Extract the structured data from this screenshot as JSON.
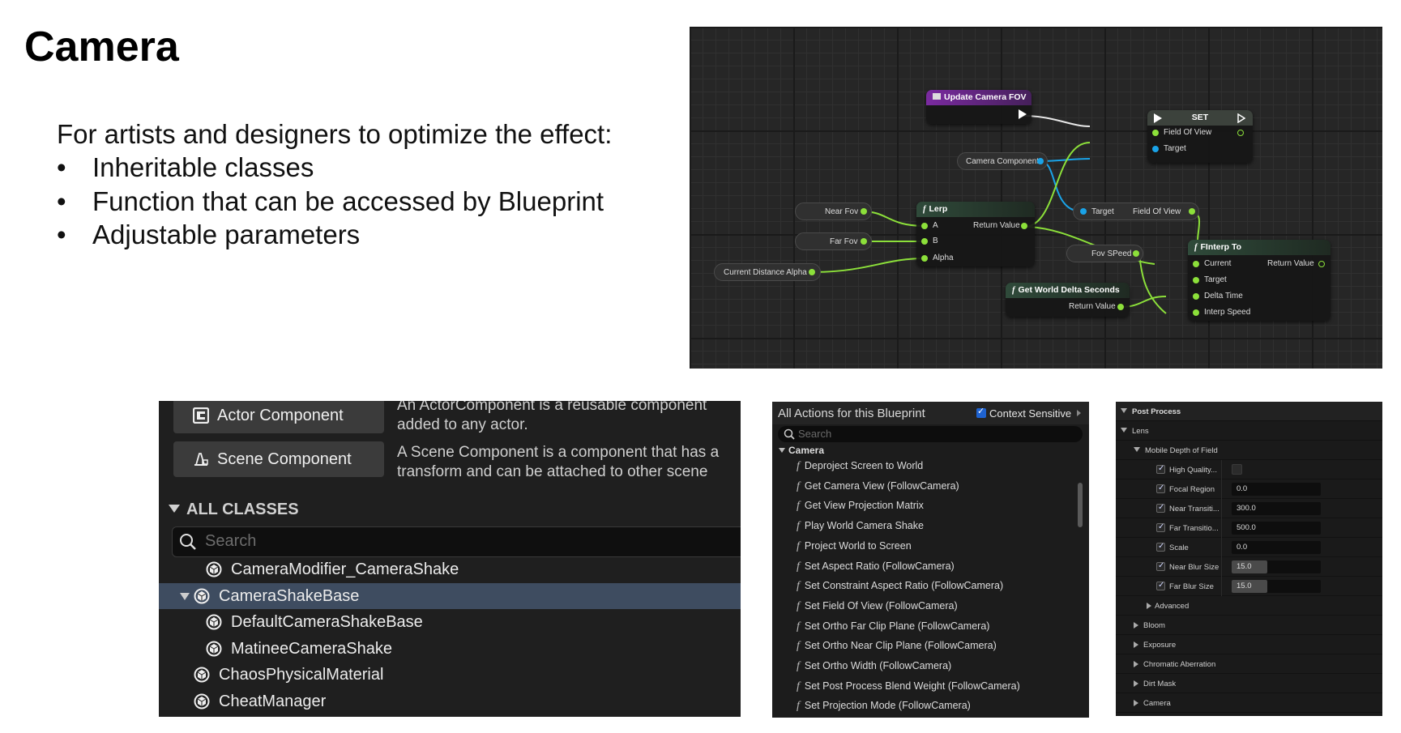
{
  "slide": {
    "title": "Camera",
    "intro": "For artists and designers to optimize the effect:",
    "bullets": [
      "Inheritable classes",
      "Function that can be accessed by Blueprint",
      "Adjustable parameters"
    ]
  },
  "blueprint": {
    "event_node": "Update Camera FOV",
    "set_node": {
      "title": "SET",
      "field_of_view": "Field Of View",
      "target": "Target"
    },
    "camera_component": "Camera Component",
    "lerp_node": {
      "title": "Lerp",
      "a": "A",
      "b": "B",
      "alpha": "Alpha",
      "return_value": "Return Value"
    },
    "near_fov": "Near Fov",
    "far_fov": "Far Fov",
    "current_distance_alpha": "Current Distance Alpha",
    "fov_getter": {
      "target": "Target",
      "field_of_view": "Field Of View"
    },
    "fov_speed": "Fov SPeed",
    "world_delta_node": {
      "title": "Get World Delta Seconds",
      "return_value": "Return Value"
    },
    "finterp_node": {
      "title": "FInterp To",
      "current": "Current",
      "target": "Target",
      "delta_time": "Delta Time",
      "interp_speed": "Interp Speed",
      "return_value": "Return Value"
    },
    "colors": {
      "float_pin": "#8ce03a",
      "object_pin": "#1aa3e8",
      "exec_pin": "#ffffff",
      "event_header": "#7a2aa0",
      "function_header": "#2f4a3a",
      "set_header": "#3a3f3a"
    }
  },
  "class_picker": {
    "buttons": [
      {
        "label": "Actor Component",
        "icon": "actor-component-icon",
        "description": [
          "An ActorComponent is a reusable component",
          "added to any actor."
        ]
      },
      {
        "label": "Scene Component",
        "icon": "scene-component-icon",
        "description": [
          "A Scene Component is a component that has a",
          "transform and can be attached to other scene"
        ]
      }
    ],
    "section_title": "ALL CLASSES",
    "search_placeholder": "Search",
    "rows": [
      {
        "label": "CameraModifier_CameraShake",
        "indent": 2,
        "selected": false
      },
      {
        "label": "CameraShakeBase",
        "indent": 1,
        "selected": true,
        "expanded": true
      },
      {
        "label": "DefaultCameraShakeBase",
        "indent": 2,
        "selected": false
      },
      {
        "label": "MatineeCameraShake",
        "indent": 2,
        "selected": false
      },
      {
        "label": "ChaosPhysicalMaterial",
        "indent": 1,
        "selected": false
      },
      {
        "label": "CheatManager",
        "indent": 1,
        "selected": false
      }
    ]
  },
  "actions_panel": {
    "title": "All Actions for this Blueprint",
    "context_sensitive": "Context Sensitive",
    "context_checked": true,
    "search_placeholder": "Search",
    "category": "Camera",
    "items": [
      "Deproject Screen to World",
      "Get Camera View (FollowCamera)",
      "Get View Projection Matrix",
      "Play World Camera Shake",
      "Project World to Screen",
      "Set Aspect Ratio (FollowCamera)",
      "Set Constraint Aspect Ratio (FollowCamera)",
      "Set Field Of View (FollowCamera)",
      "Set Ortho Far Clip Plane (FollowCamera)",
      "Set Ortho Near Clip Plane (FollowCamera)",
      "Set Ortho Width (FollowCamera)",
      "Set Post Process Blend Weight (FollowCamera)",
      "Set Projection Mode (FollowCamera)"
    ]
  },
  "post_process": {
    "section": "Post Process",
    "lens": "Lens",
    "mobile_dof": "Mobile Depth of Field",
    "props": [
      {
        "label": "High Quality...",
        "checked": true,
        "type": "checkbox",
        "value": ""
      },
      {
        "label": "Focal Region",
        "checked": true,
        "type": "text",
        "value": "0.0"
      },
      {
        "label": "Near Transiti...",
        "checked": true,
        "type": "text",
        "value": "300.0"
      },
      {
        "label": "Far Transitio...",
        "checked": true,
        "type": "text",
        "value": "500.0"
      },
      {
        "label": "Scale",
        "checked": true,
        "type": "text",
        "value": "0.0"
      },
      {
        "label": "Near Blur Size",
        "checked": true,
        "type": "slider",
        "value": "15.0",
        "fraction": 0.4
      },
      {
        "label": "Far Blur Size",
        "checked": true,
        "type": "slider",
        "value": "15.0",
        "fraction": 0.4
      }
    ],
    "advanced": "Advanced",
    "groups": [
      "Bloom",
      "Exposure",
      "Chromatic Aberration",
      "Dirt Mask",
      "Camera"
    ]
  }
}
